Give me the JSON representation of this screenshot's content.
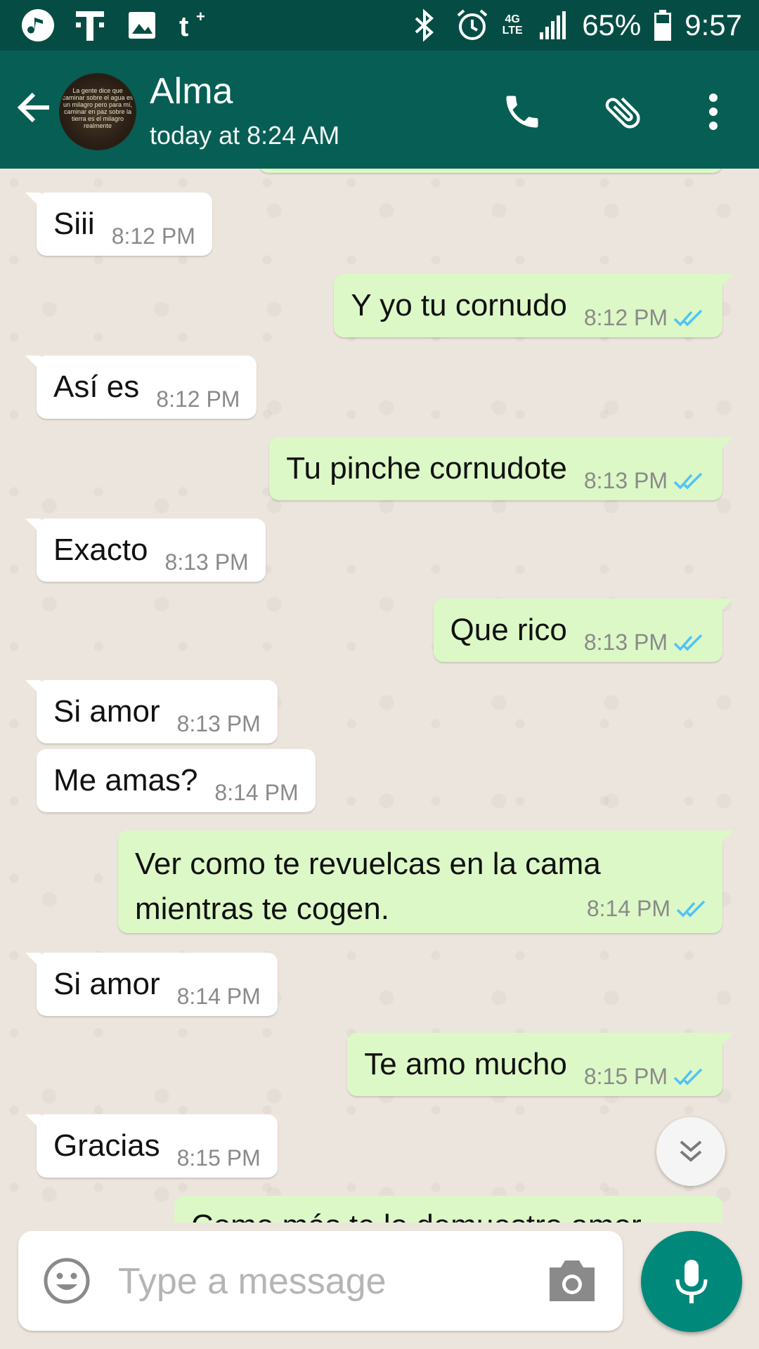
{
  "status_bar": {
    "battery": "65%",
    "time": "9:57",
    "network": "4G LTE",
    "icons": [
      "music-icon",
      "t-mobile-icon",
      "gallery-icon",
      "tumblr-icon",
      "bluetooth-icon",
      "alarm-icon",
      "signal-icon",
      "battery-icon"
    ]
  },
  "header": {
    "contact_name": "Alma",
    "contact_status": "today at 8:24 AM",
    "avatar_text": "La gente dice que caminar sobre el agua es un milagro pero para mí, caminar en paz sobre la tierra es el milagro realmente",
    "icons": [
      "back-arrow-icon",
      "phone-icon",
      "attach-icon",
      "more-vert-icon"
    ]
  },
  "messages": [
    {
      "dir": "in",
      "text": "Siii",
      "time": "8:12 PM"
    },
    {
      "dir": "out",
      "text": "Y yo tu cornudo",
      "time": "8:12 PM"
    },
    {
      "dir": "in",
      "text": "Así es",
      "time": "8:12 PM"
    },
    {
      "dir": "out",
      "text": "Tu pinche cornudote",
      "time": "8:13 PM"
    },
    {
      "dir": "in",
      "text": "Exacto",
      "time": "8:13 PM"
    },
    {
      "dir": "out",
      "text": "Que rico",
      "time": "8:13 PM"
    },
    {
      "dir": "in",
      "text": "Si amor",
      "time": "8:13 PM"
    },
    {
      "dir": "in",
      "text": "Me amas?",
      "time": "8:14 PM"
    },
    {
      "dir": "out",
      "text_line1": "Ver como te revuelcas en la cama",
      "text_line2": "mientras te cogen.",
      "time": "8:14 PM"
    },
    {
      "dir": "in",
      "text": "Si amor",
      "time": "8:14 PM"
    },
    {
      "dir": "out",
      "text": "Te amo mucho",
      "time": "8:15 PM"
    },
    {
      "dir": "in",
      "text": "Gracias",
      "time": "8:15 PM"
    },
    {
      "dir": "out",
      "text": "Como más te lo demuestro amor",
      "partial": true
    }
  ],
  "composer": {
    "placeholder": "Type a message",
    "icons": [
      "emoji-icon",
      "camera-icon",
      "mic-icon"
    ]
  },
  "colors": {
    "status_bar": "#054d44",
    "app_bar": "#075e54",
    "outgoing_bubble": "#dcf8c6",
    "incoming_bubble": "#ffffff",
    "chat_background": "#ece5dd",
    "read_ticks": "#4fc3f7",
    "mic_button": "#00897b"
  }
}
